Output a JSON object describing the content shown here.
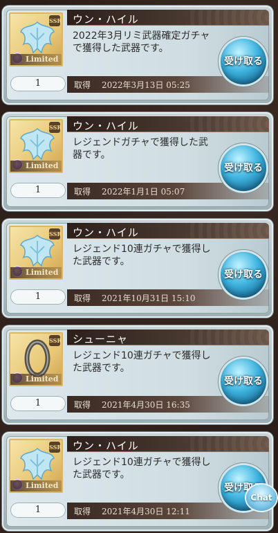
{
  "items": [
    {
      "name": "ウン・ハイル",
      "description": "2022年3月リミ武器確定ガチャで獲得した武器です。",
      "quantity": "1",
      "date_label": "取得",
      "date": "2022年3月13日 05:25",
      "receive_label": "受け取る",
      "rarity": "SSR",
      "tag": "Limited",
      "icon": "ice-crown-weapon-icon"
    },
    {
      "name": "ウン・ハイル",
      "description": "レジェンドガチャで獲得した武器です。",
      "quantity": "1",
      "date_label": "取得",
      "date": "2022年1月1日 05:07",
      "receive_label": "受け取る",
      "rarity": "SSR",
      "tag": "Limited",
      "icon": "ice-crown-weapon-icon"
    },
    {
      "name": "ウン・ハイル",
      "description": "レジェンド10連ガチャで獲得した武器です。",
      "quantity": "1",
      "date_label": "取得",
      "date": "2021年10月31日 15:10",
      "receive_label": "受け取る",
      "rarity": "SSR",
      "tag": "Limited",
      "icon": "ice-crown-weapon-icon"
    },
    {
      "name": "シューニャ",
      "description": "レジェンド10連ガチャで獲得した武器です。",
      "quantity": "1",
      "date_label": "取得",
      "date": "2021年4月30日 16:35",
      "receive_label": "受け取る",
      "rarity": "SSR",
      "tag": "Limited",
      "icon": "zero-ring-weapon-icon"
    },
    {
      "name": "ウン・ハイル",
      "description": "レジェンド10連ガチャで獲得した武器です。",
      "quantity": "1",
      "date_label": "取得",
      "date": "2021年4月30日 12:11",
      "receive_label": "受け取る",
      "rarity": "SSR",
      "tag": "Limited",
      "icon": "ice-crown-weapon-icon"
    }
  ],
  "chat_button_label": "Chat",
  "colors": {
    "card_bg": "#cfdde2",
    "name_bar": "#2c1f1a",
    "button_blue": "#3fb4e0",
    "thumb_gold": "#e8c877"
  }
}
